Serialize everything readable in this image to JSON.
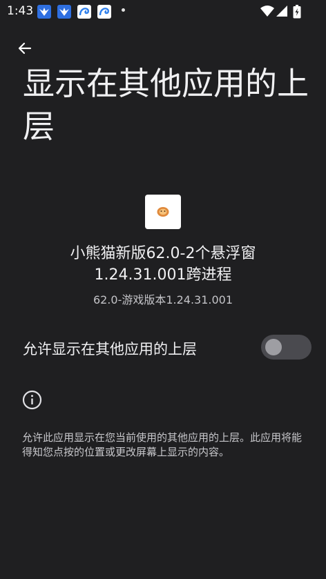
{
  "status_bar": {
    "time": "1:43"
  },
  "page": {
    "title": "显示在其他应用的上层"
  },
  "app": {
    "name_line1": "小熊猫新版62.0-2个悬浮窗",
    "name_line2": "1.24.31.001跨进程",
    "version": "62.0-游戏版本1.24.31.001"
  },
  "permission": {
    "label": "允许显示在其他应用的上层",
    "enabled": false
  },
  "description": {
    "text": "允许此应用显示在您当前使用的其他应用的上层。此应用将能得知您点按的位置或更改屏幕上显示的内容。"
  },
  "icons": {
    "back": "back-arrow-icon",
    "info": "info-icon",
    "app": "app-icon",
    "wifi": "wifi-icon",
    "signal": "signal-icon",
    "battery": "battery-icon"
  },
  "colors": {
    "background": "#1f1f21",
    "toggle_track_off": "#4a4a4f",
    "toggle_thumb_off": "#9e9ea3",
    "notification_blue": "#2f6fe0"
  }
}
